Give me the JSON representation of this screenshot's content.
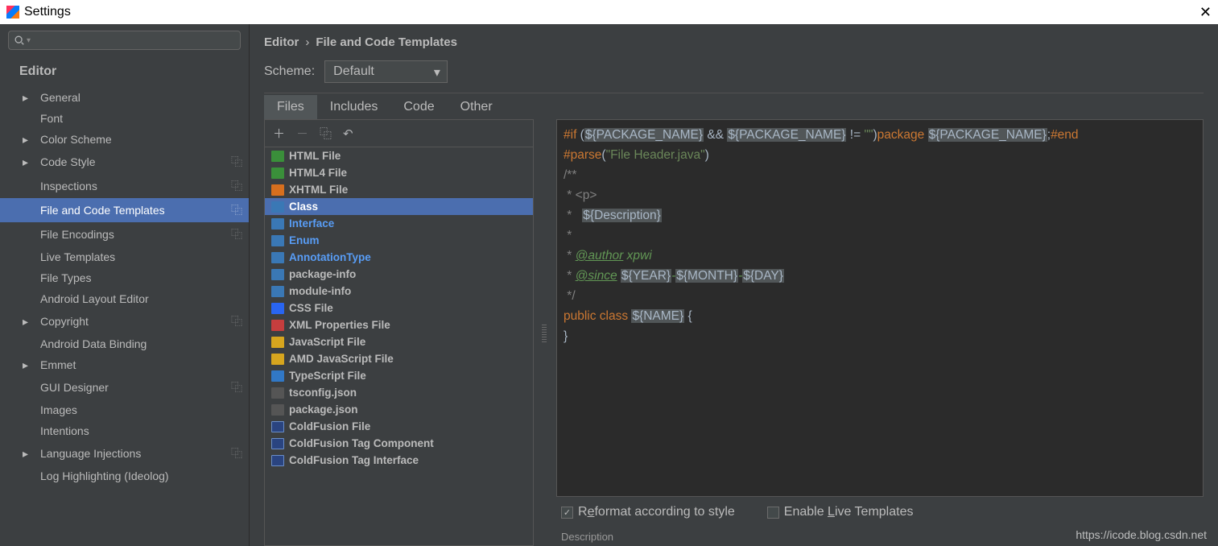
{
  "window": {
    "title": "Settings"
  },
  "breadcrumb": {
    "root": "Editor",
    "leaf": "File and Code Templates"
  },
  "scheme": {
    "label": "Scheme:",
    "value": "Default"
  },
  "sidebar": {
    "header": "Editor",
    "items": [
      {
        "label": "General",
        "arrow": true
      },
      {
        "label": "Font"
      },
      {
        "label": "Color Scheme",
        "arrow": true
      },
      {
        "label": "Code Style",
        "arrow": true,
        "copy": true
      },
      {
        "label": "Inspections",
        "copy": true
      },
      {
        "label": "File and Code Templates",
        "copy": true,
        "selected": true
      },
      {
        "label": "File Encodings",
        "copy": true
      },
      {
        "label": "Live Templates"
      },
      {
        "label": "File Types"
      },
      {
        "label": "Android Layout Editor"
      },
      {
        "label": "Copyright",
        "arrow": true,
        "copy": true
      },
      {
        "label": "Android Data Binding"
      },
      {
        "label": "Emmet",
        "arrow": true
      },
      {
        "label": "GUI Designer",
        "copy": true
      },
      {
        "label": "Images"
      },
      {
        "label": "Intentions"
      },
      {
        "label": "Language Injections",
        "arrow": true,
        "copy": true
      },
      {
        "label": "Log Highlighting (Ideolog)"
      }
    ]
  },
  "tabs": [
    {
      "label": "Files",
      "active": true
    },
    {
      "label": "Includes"
    },
    {
      "label": "Code"
    },
    {
      "label": "Other"
    }
  ],
  "templates": [
    {
      "label": "HTML File",
      "icon": "ic-html"
    },
    {
      "label": "HTML4 File",
      "icon": "ic-html4"
    },
    {
      "label": "XHTML File",
      "icon": "ic-xhtml"
    },
    {
      "label": "Class",
      "icon": "ic-java",
      "selected": true
    },
    {
      "label": "Interface",
      "icon": "ic-java",
      "blue": true
    },
    {
      "label": "Enum",
      "icon": "ic-java",
      "blue": true
    },
    {
      "label": "AnnotationType",
      "icon": "ic-java",
      "blue": true
    },
    {
      "label": "package-info",
      "icon": "ic-java"
    },
    {
      "label": "module-info",
      "icon": "ic-java"
    },
    {
      "label": "CSS File",
      "icon": "ic-css"
    },
    {
      "label": "XML Properties File",
      "icon": "ic-xml"
    },
    {
      "label": "JavaScript File",
      "icon": "ic-js"
    },
    {
      "label": "AMD JavaScript File",
      "icon": "ic-js"
    },
    {
      "label": "TypeScript File",
      "icon": "ic-ts"
    },
    {
      "label": "tsconfig.json",
      "icon": "ic-json"
    },
    {
      "label": "package.json",
      "icon": "ic-json"
    },
    {
      "label": "ColdFusion File",
      "icon": "ic-cf"
    },
    {
      "label": "ColdFusion Tag Component",
      "icon": "ic-cf"
    },
    {
      "label": "ColdFusion Tag Interface",
      "icon": "ic-cf"
    }
  ],
  "code": {
    "l1a": "#if",
    "l1b": " (",
    "l1v1": "${PACKAGE_NAME}",
    "l1c": " && ",
    "l1v2": "${PACKAGE_NAME}",
    "l1d": " != ",
    "l1s": "\"\"",
    "l1e": ")",
    "l1pkg": "package ",
    "l1v3": "${PACKAGE_NAME}",
    "l1semi": ";",
    "l1end": "#end",
    "l2a": "#parse",
    "l2b": "(",
    "l2s": "\"File Header.java\"",
    "l2c": ")",
    "l3": "/**",
    "l4": " * <p>",
    "l5a": " *   ",
    "l5v": "${Description}",
    "l6": " *",
    "l7a": " * ",
    "l7tag": "@author",
    "l7b": " xpwi",
    "l8a": " * ",
    "l8tag": "@since",
    "l8b": " ",
    "l8v1": "${YEAR}",
    "l8d1": "-",
    "l8v2": "${MONTH}",
    "l8d2": "-",
    "l8v3": "${DAY}",
    "l9": " */",
    "l10a": "public class ",
    "l10v": "${NAME}",
    "l10b": " {",
    "l11": "}"
  },
  "opts": {
    "reformat_pre": "R",
    "reformat_u": "e",
    "reformat_post": "format according to style",
    "reformat_checked": true,
    "live_pre": "Enable ",
    "live_u": "L",
    "live_post": "ive Templates",
    "live_checked": false
  },
  "desc": {
    "label": "Description"
  },
  "watermark": "https://icode.blog.csdn.net"
}
